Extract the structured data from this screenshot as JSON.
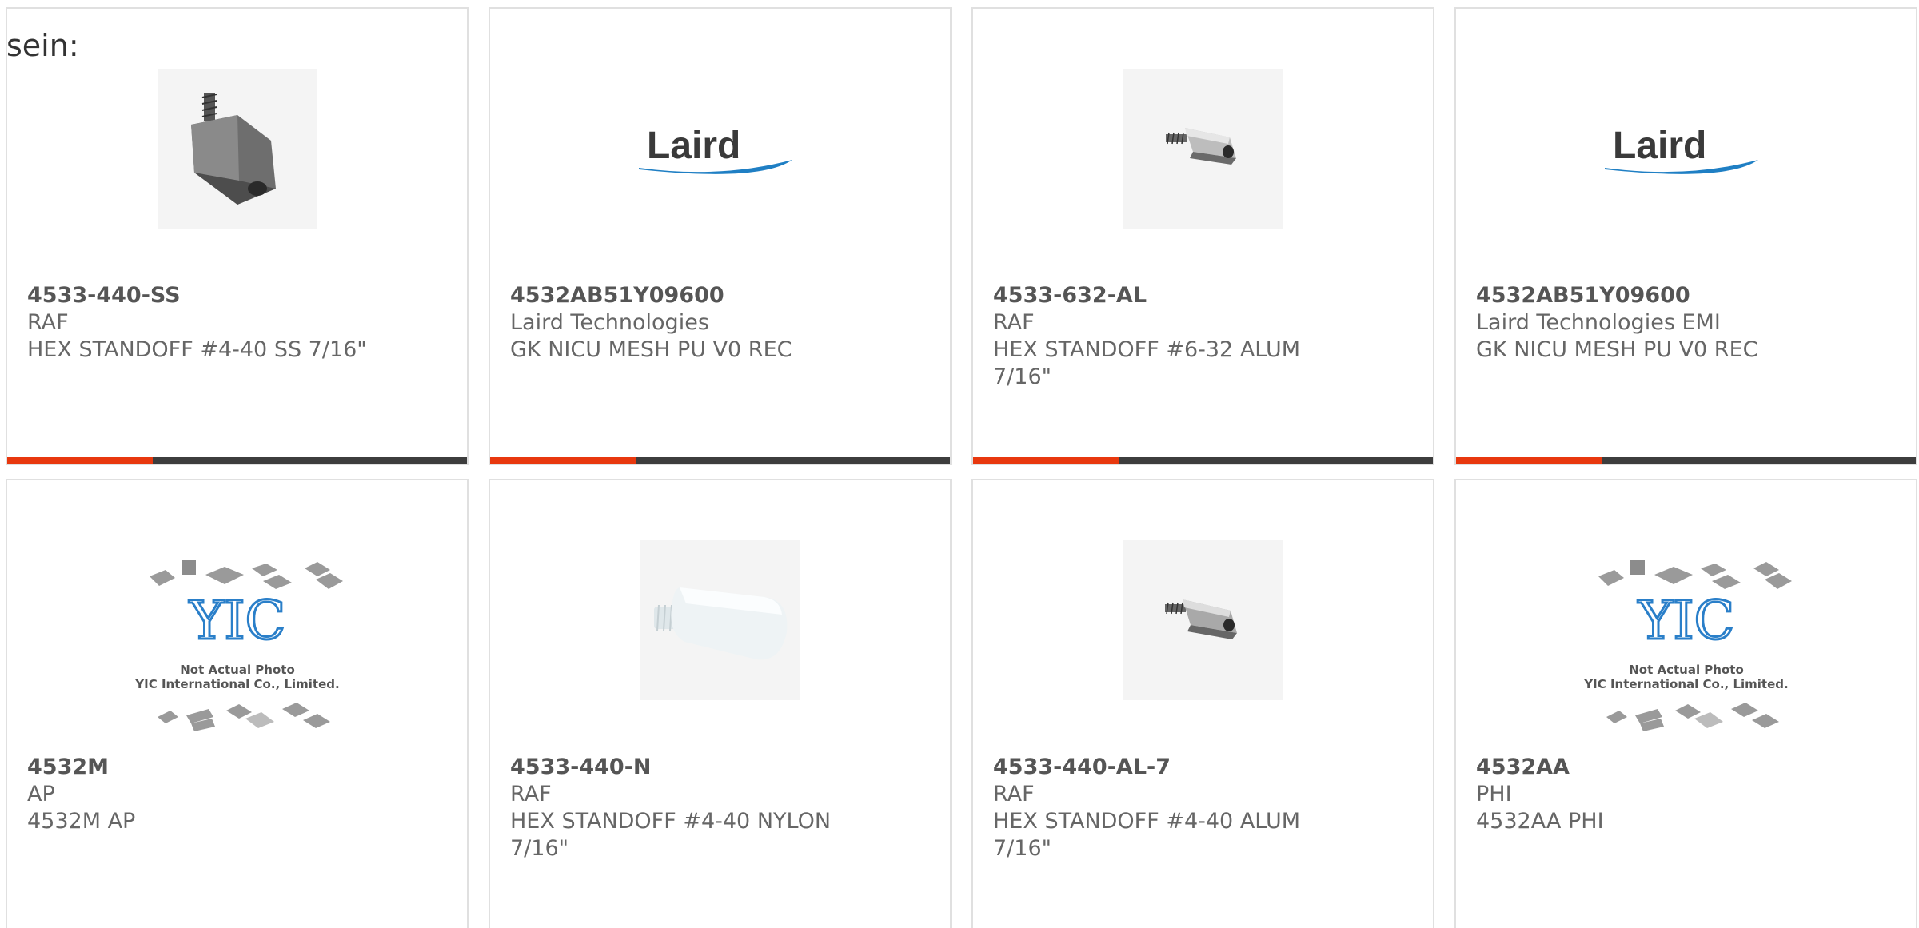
{
  "top_note": "sein:",
  "colors": {
    "accent": "#e8380e",
    "bar": "#3d3d3d",
    "border": "#e0e0e0",
    "laird_blue": "#1f7fc4",
    "yic_blue": "#2a7fc9"
  },
  "products": [
    {
      "part_number": "4533-440-SS",
      "manufacturer": "RAF",
      "description_lines": [
        "HEX STANDOFF #4-40 SS 7/16\""
      ],
      "image": "hex-standoff-steel-photo"
    },
    {
      "part_number": "4532AB51Y09600",
      "manufacturer": "Laird Technologies",
      "description_lines": [
        "GK NICU MESH PU V0 REC"
      ],
      "image": "laird-logo",
      "logo_text": "Laird"
    },
    {
      "part_number": "4533-632-AL",
      "manufacturer": "RAF",
      "description_lines": [
        "HEX STANDOFF #6-32 ALUM",
        "7/16\""
      ],
      "image": "hex-standoff-aluminum-photo"
    },
    {
      "part_number": "4532AB51Y09600",
      "manufacturer": "Laird Technologies EMI",
      "description_lines": [
        "GK NICU MESH PU V0 REC"
      ],
      "image": "laird-logo",
      "logo_text": "Laird"
    },
    {
      "part_number": "4532M",
      "manufacturer": "AP",
      "description_lines": [
        "4532M AP"
      ],
      "image": "yic-placeholder",
      "placeholder_line1": "Not Actual Photo",
      "placeholder_line2": "YIC International Co., Limited."
    },
    {
      "part_number": "4533-440-N",
      "manufacturer": "RAF",
      "description_lines": [
        "HEX STANDOFF #4-40 NYLON",
        "7/16\""
      ],
      "image": "nylon-standoff-photo"
    },
    {
      "part_number": "4533-440-AL-7",
      "manufacturer": "RAF",
      "description_lines": [
        "HEX STANDOFF #4-40 ALUM",
        "7/16\""
      ],
      "image": "hex-standoff-aluminum-photo"
    },
    {
      "part_number": "4532AA",
      "manufacturer": "PHI",
      "description_lines": [
        "4532AA PHI"
      ],
      "image": "yic-placeholder",
      "placeholder_line1": "Not Actual Photo",
      "placeholder_line2": "YIC International Co., Limited."
    }
  ]
}
